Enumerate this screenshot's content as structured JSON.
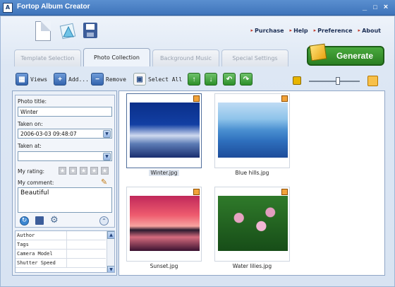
{
  "window": {
    "title": "Fortop Album Creator",
    "controls": {
      "minimize": "_",
      "maximize": "□",
      "close": "×"
    }
  },
  "top_links": [
    "Purchase",
    "Help",
    "Preference",
    "About"
  ],
  "tabs": [
    {
      "label": "Template Selection",
      "active": false
    },
    {
      "label": "Photo Collection",
      "active": true
    },
    {
      "label": "Background Music",
      "active": false
    },
    {
      "label": "Special Settings",
      "active": false
    }
  ],
  "generate_label": "Generate",
  "toolbar": {
    "views_label": "Views",
    "add_label": "Add...",
    "remove_label": "Remove",
    "select_all_label": "Select All"
  },
  "props": {
    "photo_title_label": "Photo title:",
    "photo_title_value": "Winter",
    "taken_on_label": "Taken on:",
    "taken_on_value": "2006-03-03 09:48:07",
    "taken_at_label": "Taken at:",
    "taken_at_value": "",
    "rating_label": "My rating:",
    "comment_label": "My comment:",
    "comment_value": "Beautiful"
  },
  "exif_rows": [
    "Author",
    "Tags",
    "Camera Model",
    "Shutter Speed"
  ],
  "photos": [
    {
      "caption": "Winter.jpg",
      "selected": true
    },
    {
      "caption": "Blue hills.jpg",
      "selected": false
    },
    {
      "caption": "Sunset.jpg",
      "selected": false
    },
    {
      "caption": "Water lilies.jpg",
      "selected": false
    }
  ],
  "colors": {
    "title_bar": "#4a82c6",
    "generate_button": "#2b8a22",
    "accent_arrow": "#c0392b"
  }
}
